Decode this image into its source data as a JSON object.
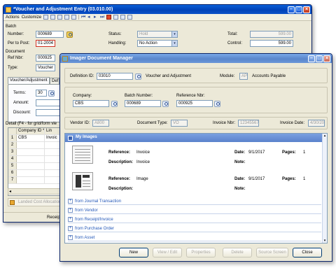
{
  "main_window": {
    "title": "*Voucher and Adjustment Entry (03.010.00)",
    "menu": {
      "actions": "Actions",
      "customize": "Customize"
    },
    "batch": {
      "section_label": "Batch",
      "number_label": "Number:",
      "number_value": "000689",
      "perpost_label": "Per to Post:",
      "perpost_value": "01-2004",
      "status_label": "Status:",
      "status_value": "Hold",
      "handling_label": "Handling:",
      "handling_value": "No Action",
      "total_label": "Total:",
      "total_value": "599.00",
      "control_label": "Control:",
      "control_value": "599.00"
    },
    "document": {
      "section_label": "Document",
      "refnbr_label": "Ref Nbr:",
      "refnbr_value": "000925",
      "type_label": "Type:",
      "type_value": "Voucher"
    },
    "tabs": [
      "Voucher/Adjustment",
      "Def"
    ],
    "terms_label": "Terms:",
    "terms_value": "30",
    "amount_label": "Amount:",
    "discount_label": "Discount:",
    "detail_label": "Detail (F4 - for grid/form vie",
    "grid": {
      "headers": [
        "Company ID *",
        "Lin"
      ],
      "rows": [
        {
          "num": "1",
          "company": "CBS",
          "lin": "Invoic"
        },
        {
          "num": "2",
          "company": "",
          "lin": ""
        },
        {
          "num": "3",
          "company": "",
          "lin": ""
        },
        {
          "num": "4",
          "company": "",
          "lin": ""
        },
        {
          "num": "5",
          "company": "",
          "lin": ""
        },
        {
          "num": "6",
          "company": "",
          "lin": ""
        },
        {
          "num": "7",
          "company": "",
          "lin": ""
        }
      ]
    },
    "landed_cost_label": "Landed Cost Allocation",
    "receipt_label": "Receipt"
  },
  "dialog": {
    "title": "Imager Document Manager",
    "definition_label": "Definition ID:",
    "definition_value": "03010",
    "definition_desc": "Voucher and Adjustment",
    "module_label": "Module:",
    "module_value": "AP",
    "module_desc": "Accounts Payable",
    "company_label": "Company:",
    "company_value": "CBS",
    "batch_label": "Batch Number:",
    "batch_value": "000689",
    "reference_label": "Reference Nbr:",
    "reference_value": "000925",
    "vendor_label": "Vendor ID:",
    "vendor_value": "A800",
    "doctype_label": "Document Type:",
    "doctype_value": "VO",
    "invnbr_label": "Invoice Nbr:",
    "invnbr_value": "12345567",
    "invdate_label": "Invoice Date:",
    "invdate_value": "4/30/20",
    "myimages_label": "My Images",
    "images": [
      {
        "reference_label": "Reference:",
        "reference": "Invoice",
        "description_label": "Description:",
        "description": "Invoice",
        "date_label": "Date:",
        "date": "9/1/2017",
        "pages_label": "Pages:",
        "pages": "1",
        "note_label": "Note:"
      },
      {
        "reference_label": "Reference:",
        "reference": "Image",
        "description_label": "Description:",
        "description": "",
        "date_label": "Date:",
        "date": "9/1/2017",
        "pages_label": "Pages:",
        "pages": "1",
        "note_label": "Note:"
      }
    ],
    "sections": [
      "from Journal Transaction",
      "from Vendor",
      "from Receipt/Invoice",
      "from Purchase Order",
      "from Asset"
    ],
    "buttons": {
      "new": "New",
      "view_edit": "View / Edit",
      "properties": "Properties",
      "delete": "Delete",
      "source_screen": "Source Screen",
      "close": "Close"
    }
  }
}
